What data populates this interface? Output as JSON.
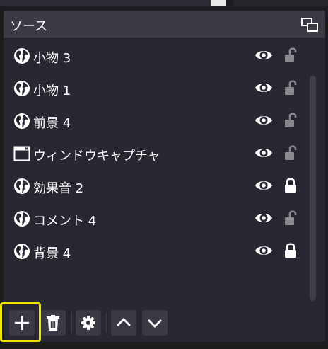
{
  "panel": {
    "title": "ソース",
    "title_color": "#3a3b45",
    "background": "#272831"
  },
  "sources": [
    {
      "name": "小物 3",
      "icon": "globe-icon",
      "visible": true,
      "locked": false
    },
    {
      "name": "小物 1",
      "icon": "globe-icon",
      "visible": true,
      "locked": false
    },
    {
      "name": "前景 4",
      "icon": "globe-icon",
      "visible": true,
      "locked": false
    },
    {
      "name": "ウィンドウキャプチャ",
      "icon": "window-capture-icon",
      "visible": true,
      "locked": false
    },
    {
      "name": "効果音 2",
      "icon": "globe-icon",
      "visible": true,
      "locked": true
    },
    {
      "name": "コメント 4",
      "icon": "globe-icon",
      "visible": true,
      "locked": false
    },
    {
      "name": "背景 4",
      "icon": "globe-icon",
      "visible": true,
      "locked": true
    }
  ],
  "toolbar": {
    "buttons": [
      "plus-icon",
      "trash-icon",
      "gear-icon",
      "chevron-up-icon",
      "chevron-down-icon"
    ],
    "highlight_color": "#f0e400"
  }
}
